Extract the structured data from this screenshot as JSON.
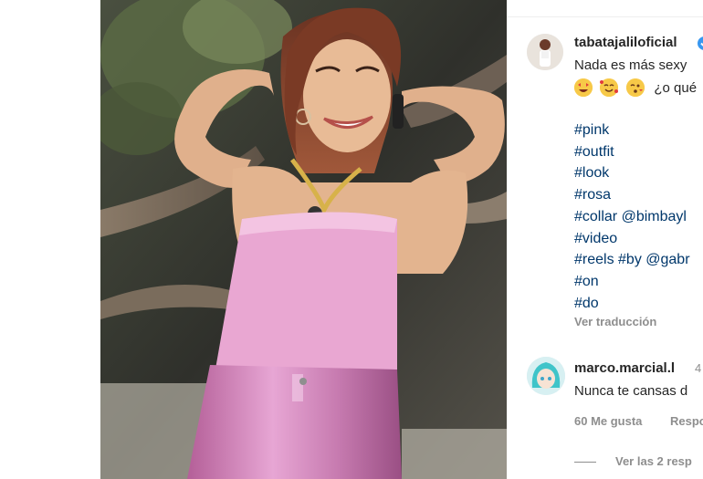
{
  "post": {
    "author": "tabatajaliloficial",
    "caption_line1": "Nada es más sexy",
    "caption_emoji_names": [
      "star-struck",
      "smiling-hearts",
      "kissing-heart"
    ],
    "caption_after_emojis": "¿o qué",
    "hashtags": [
      "#pink",
      "#outfit",
      "#look",
      "#rosa",
      "#collar @bimbayl",
      "#video",
      "#reels #by @gabr",
      "#on",
      "#do"
    ],
    "translate_label": "Ver traducción"
  },
  "comment": {
    "author": "marco.marcial.l",
    "time": "4",
    "text": "Nunca te cansas d",
    "likes_label": "60 Me gusta",
    "reply_label": "Respo",
    "view_replies_label": "Ver las 2 resp"
  },
  "colors": {
    "link": "#00376b",
    "muted": "#8e8e8e",
    "text": "#262626",
    "verified": "#3897f0",
    "top_pink": "#e9a7d2",
    "pants_pink": "#c77bb0"
  },
  "icons": [
    "verified-badge-icon",
    "emoji-icon"
  ]
}
